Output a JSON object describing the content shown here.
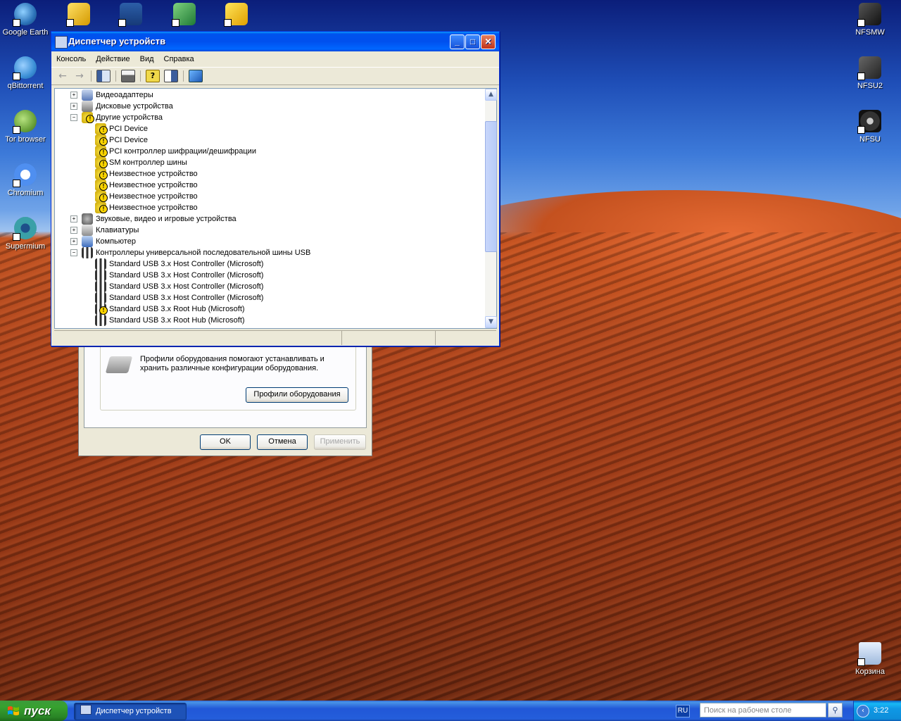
{
  "desktop": {
    "icons_left": [
      {
        "label": "Google Earth",
        "icon": "google-earth-icon",
        "color": "#2c73b9"
      },
      {
        "label": "qBittorrent",
        "icon": "qbittorrent-icon",
        "color": "#3b8fd6"
      },
      {
        "label": "Tor browser",
        "icon": "tor-browser-icon",
        "color": "#6aa23a"
      },
      {
        "label": "Chromium",
        "icon": "chromium-icon",
        "color": "#4f8ff0"
      },
      {
        "label": "Supermium",
        "icon": "supermium-icon",
        "color": "#3aa0a8"
      }
    ],
    "icons_top": [
      {
        "label": "",
        "icon": "app-icon-1"
      },
      {
        "label": "",
        "icon": "app-icon-2"
      },
      {
        "label": "",
        "icon": "excel-icon"
      },
      {
        "label": "",
        "icon": "pdf-icon"
      }
    ],
    "icons_right": [
      {
        "label": "NFSMW",
        "icon": "nfsmw-icon"
      },
      {
        "label": "NFSU2",
        "icon": "nfsu2-icon"
      },
      {
        "label": "NFSU",
        "icon": "nfsu-icon"
      }
    ],
    "recycle_bin": {
      "label": "Корзина",
      "icon": "recycle-bin-icon"
    }
  },
  "device_manager": {
    "title": "Диспетчер устройств",
    "menu": [
      "Консоль",
      "Действие",
      "Вид",
      "Справка"
    ],
    "tree": [
      {
        "label": "Видеоадаптеры",
        "level": 0,
        "expander": "+",
        "icon": "display-adapter-icon"
      },
      {
        "label": "Дисковые устройства",
        "level": 0,
        "expander": "+",
        "icon": "disk-drive-icon"
      },
      {
        "label": "Другие устройства",
        "level": 0,
        "expander": "−",
        "icon": "unknown-devices-icon"
      },
      {
        "label": "PCI Device",
        "level": 1,
        "icon": "warning-device-icon"
      },
      {
        "label": "PCI Device",
        "level": 1,
        "icon": "warning-device-icon"
      },
      {
        "label": "PCI контроллер шифрации/дешифрации",
        "level": 1,
        "icon": "warning-device-icon"
      },
      {
        "label": "SM контроллер шины",
        "level": 1,
        "icon": "warning-device-icon"
      },
      {
        "label": "Неизвестное устройство",
        "level": 1,
        "icon": "warning-device-icon"
      },
      {
        "label": "Неизвестное устройство",
        "level": 1,
        "icon": "warning-device-icon"
      },
      {
        "label": "Неизвестное устройство",
        "level": 1,
        "icon": "warning-device-icon"
      },
      {
        "label": "Неизвестное устройство",
        "level": 1,
        "icon": "warning-device-icon"
      },
      {
        "label": "Звуковые, видео и игровые устройства",
        "level": 0,
        "expander": "+",
        "icon": "sound-icon"
      },
      {
        "label": "Клавиатуры",
        "level": 0,
        "expander": "+",
        "icon": "keyboard-icon"
      },
      {
        "label": "Компьютер",
        "level": 0,
        "expander": "+",
        "icon": "computer-icon"
      },
      {
        "label": "Контроллеры универсальной последовательной шины USB",
        "level": 0,
        "expander": "−",
        "icon": "usb-icon"
      },
      {
        "label": "Standard USB 3.x Host Controller (Microsoft)",
        "level": 1,
        "icon": "usb-icon"
      },
      {
        "label": "Standard USB 3.x Host Controller (Microsoft)",
        "level": 1,
        "icon": "usb-icon"
      },
      {
        "label": "Standard USB 3.x Host Controller (Microsoft)",
        "level": 1,
        "icon": "usb-icon"
      },
      {
        "label": "Standard USB 3.x Host Controller (Microsoft)",
        "level": 1,
        "icon": "usb-icon"
      },
      {
        "label": "Standard USB 3.x Root Hub (Microsoft)",
        "level": 1,
        "icon": "usb-warning-icon"
      },
      {
        "label": "Standard USB 3.x Root Hub (Microsoft)",
        "level": 1,
        "icon": "usb-icon"
      }
    ]
  },
  "system_properties": {
    "profiles_text_line1": "Профили оборудования помогают устанавливать и",
    "profiles_text_line2": "хранить различные конфигурации оборудования.",
    "profiles_button": "Профили оборудования",
    "ok": "OK",
    "cancel": "Отмена",
    "apply": "Применить"
  },
  "taskbar": {
    "start_label": "пуск",
    "task_button": "Диспетчер устройств",
    "language": "RU",
    "search_placeholder": "Поиск на рабочем столе",
    "clock": "3:22"
  }
}
